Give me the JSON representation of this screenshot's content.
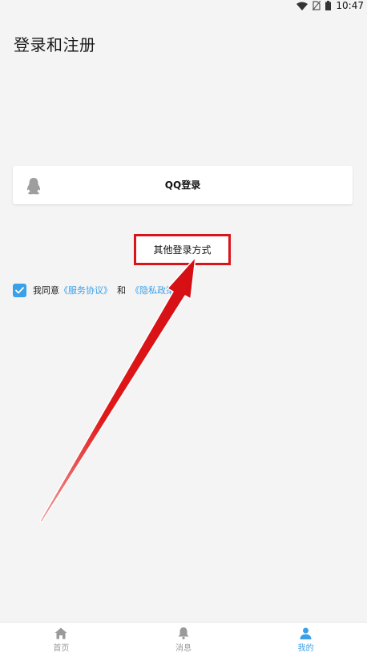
{
  "status_bar": {
    "time": "10:47",
    "icons": [
      "wifi-icon",
      "no-sim-icon",
      "battery-icon"
    ]
  },
  "header": {
    "title": "登录和注册"
  },
  "login": {
    "qq_label": "QQ登录",
    "qq_icon": "qq-penguin-icon",
    "other_label": "其他登录方式"
  },
  "agreement": {
    "checked": true,
    "prefix": "我同意",
    "service_link": "《服务协议》",
    "conjunction": "和",
    "privacy_link": "《隐私政策》"
  },
  "tabs": [
    {
      "label": "首页",
      "icon": "home-icon",
      "active": false
    },
    {
      "label": "消息",
      "icon": "bell-icon",
      "active": false
    },
    {
      "label": "我的",
      "icon": "person-icon",
      "active": true
    }
  ],
  "colors": {
    "background": "#f4f4f4",
    "accent": "#3aa0e8",
    "annotation_red": "#d9141b"
  }
}
